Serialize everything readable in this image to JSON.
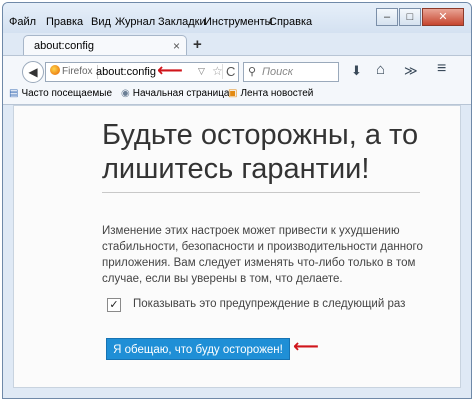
{
  "menu": [
    "Файл",
    "Правка",
    "Вид",
    "Журнал",
    "Закладки",
    "Инструменты",
    "Справка"
  ],
  "window_controls": {
    "minimize": "–",
    "maximize": "□",
    "close": "✕"
  },
  "tab": {
    "title": "about:config",
    "close": "×",
    "new_tab": "+"
  },
  "nav": {
    "back": "◀",
    "identity": "Firefox",
    "url": "about:config",
    "dropdown": "▽",
    "star": "☆",
    "reload": "C",
    "search_placeholder": "Поиск",
    "search_glyph": "⚲",
    "download": "⬇",
    "home": "⌂",
    "overflow": "≫",
    "menu": "≡"
  },
  "bookmarks": [
    {
      "label": "Часто посещаемые",
      "icon": "bookmark-folder-icon"
    },
    {
      "label": "Начальная страница",
      "icon": "globe-icon"
    },
    {
      "label": "Лента новостей",
      "icon": "rss-icon"
    }
  ],
  "content": {
    "heading": "Будьте осторожны, а то лишитесь гарантии!",
    "warning": "Изменение этих настроек может привести к ухудшению стабильности, безопасности и производительности данного приложения. Вам следует изменять что-либо только в том случае, если вы уверены в том, что делаете.",
    "checkbox_checked": true,
    "checkbox_mark": "✓",
    "checkbox_label": "Показывать это предупреждение в следующий раз",
    "button_label": "Я обещаю, что буду осторожен!"
  },
  "annotations": {
    "arrow_glyph": "⟵",
    "arrow_color": "#d0151b"
  }
}
